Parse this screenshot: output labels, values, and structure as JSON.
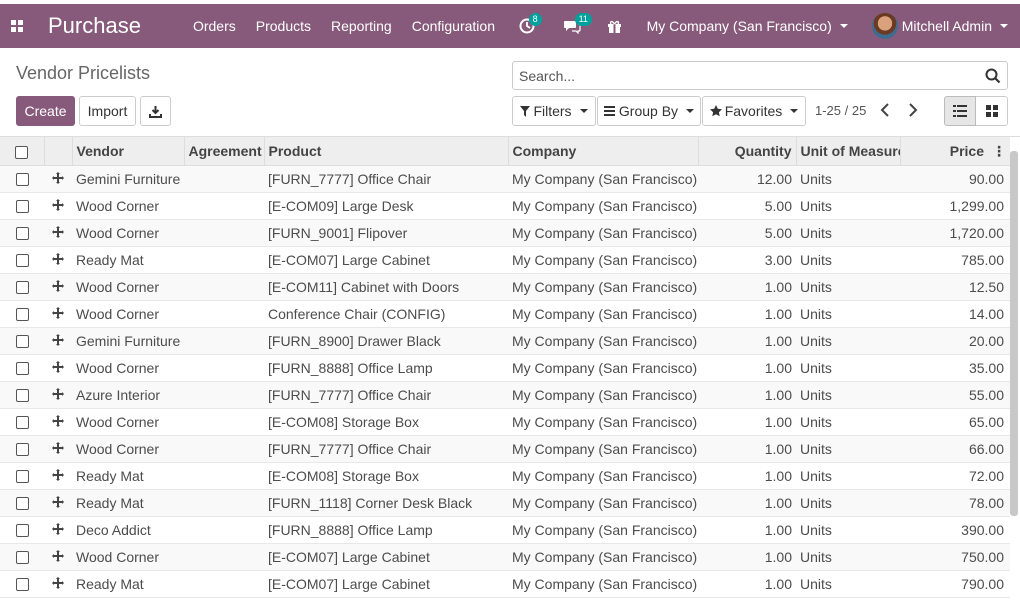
{
  "navbar": {
    "app_name": "Purchase",
    "menu": [
      "Orders",
      "Products",
      "Reporting",
      "Configuration"
    ],
    "activity_count": "8",
    "message_count": "11",
    "company": "My Company (San Francisco)",
    "user": "Mitchell Admin",
    "color": "#875a7b"
  },
  "control": {
    "title": "Vendor Pricelists",
    "search_placeholder": "Search...",
    "create_label": "Create",
    "import_label": "Import",
    "filters_label": "Filters",
    "group_by_label": "Group By",
    "favorites_label": "Favorites",
    "pager": "1-25 / 25"
  },
  "table": {
    "columns": [
      "Vendor",
      "Agreement",
      "Product",
      "Company",
      "Quantity",
      "Unit of Measure",
      "Price"
    ],
    "rows": [
      {
        "vendor": "Gemini Furniture",
        "agreement": "",
        "product": "[FURN_7777] Office Chair",
        "company": "My Company (San Francisco)",
        "quantity": "12.00",
        "uom": "Units",
        "price": "90.00"
      },
      {
        "vendor": "Wood Corner",
        "agreement": "",
        "product": "[E-COM09] Large Desk",
        "company": "My Company (San Francisco)",
        "quantity": "5.00",
        "uom": "Units",
        "price": "1,299.00"
      },
      {
        "vendor": "Wood Corner",
        "agreement": "",
        "product": "[FURN_9001] Flipover",
        "company": "My Company (San Francisco)",
        "quantity": "5.00",
        "uom": "Units",
        "price": "1,720.00"
      },
      {
        "vendor": "Ready Mat",
        "agreement": "",
        "product": "[E-COM07] Large Cabinet",
        "company": "My Company (San Francisco)",
        "quantity": "3.00",
        "uom": "Units",
        "price": "785.00"
      },
      {
        "vendor": "Wood Corner",
        "agreement": "",
        "product": "[E-COM11] Cabinet with Doors",
        "company": "My Company (San Francisco)",
        "quantity": "1.00",
        "uom": "Units",
        "price": "12.50"
      },
      {
        "vendor": "Wood Corner",
        "agreement": "",
        "product": "Conference Chair (CONFIG)",
        "company": "My Company (San Francisco)",
        "quantity": "1.00",
        "uom": "Units",
        "price": "14.00"
      },
      {
        "vendor": "Gemini Furniture",
        "agreement": "",
        "product": "[FURN_8900] Drawer Black",
        "company": "My Company (San Francisco)",
        "quantity": "1.00",
        "uom": "Units",
        "price": "20.00"
      },
      {
        "vendor": "Wood Corner",
        "agreement": "",
        "product": "[FURN_8888] Office Lamp",
        "company": "My Company (San Francisco)",
        "quantity": "1.00",
        "uom": "Units",
        "price": "35.00"
      },
      {
        "vendor": "Azure Interior",
        "agreement": "",
        "product": "[FURN_7777] Office Chair",
        "company": "My Company (San Francisco)",
        "quantity": "1.00",
        "uom": "Units",
        "price": "55.00"
      },
      {
        "vendor": "Wood Corner",
        "agreement": "",
        "product": "[E-COM08] Storage Box",
        "company": "My Company (San Francisco)",
        "quantity": "1.00",
        "uom": "Units",
        "price": "65.00"
      },
      {
        "vendor": "Wood Corner",
        "agreement": "",
        "product": "[FURN_7777] Office Chair",
        "company": "My Company (San Francisco)",
        "quantity": "1.00",
        "uom": "Units",
        "price": "66.00"
      },
      {
        "vendor": "Ready Mat",
        "agreement": "",
        "product": "[E-COM08] Storage Box",
        "company": "My Company (San Francisco)",
        "quantity": "1.00",
        "uom": "Units",
        "price": "72.00"
      },
      {
        "vendor": "Ready Mat",
        "agreement": "",
        "product": "[FURN_1118] Corner Desk Black",
        "company": "My Company (San Francisco)",
        "quantity": "1.00",
        "uom": "Units",
        "price": "78.00"
      },
      {
        "vendor": "Deco Addict",
        "agreement": "",
        "product": "[FURN_8888] Office Lamp",
        "company": "My Company (San Francisco)",
        "quantity": "1.00",
        "uom": "Units",
        "price": "390.00"
      },
      {
        "vendor": "Wood Corner",
        "agreement": "",
        "product": "[E-COM07] Large Cabinet",
        "company": "My Company (San Francisco)",
        "quantity": "1.00",
        "uom": "Units",
        "price": "750.00"
      },
      {
        "vendor": "Ready Mat",
        "agreement": "",
        "product": "[E-COM07] Large Cabinet",
        "company": "My Company (San Francisco)",
        "quantity": "1.00",
        "uom": "Units",
        "price": "790.00"
      }
    ]
  }
}
